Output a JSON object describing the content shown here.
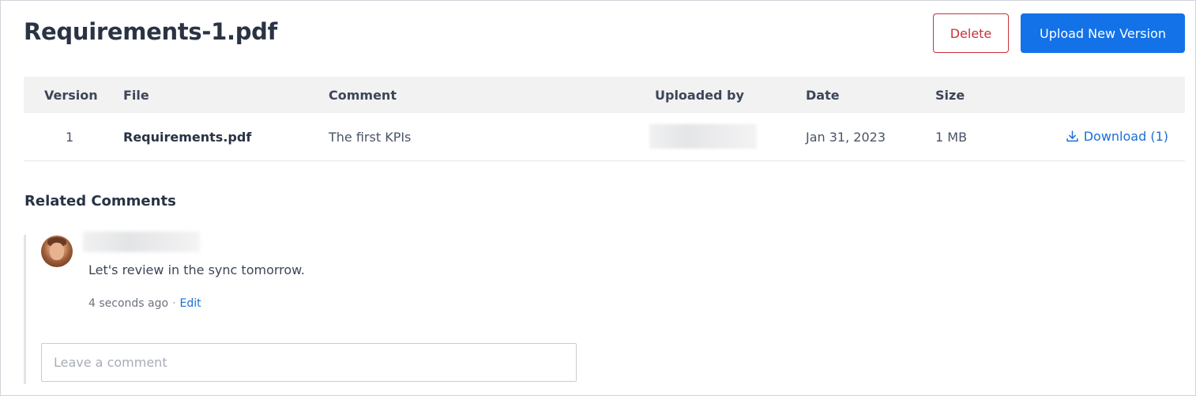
{
  "document": {
    "title": "Requirements-1.pdf"
  },
  "actions": {
    "delete_label": "Delete",
    "upload_label": "Upload New Version"
  },
  "table": {
    "headers": {
      "version": "Version",
      "file": "File",
      "comment": "Comment",
      "uploaded_by": "Uploaded by",
      "date": "Date",
      "size": "Size"
    },
    "rows": [
      {
        "version": "1",
        "file": "Requirements.pdf",
        "comment": "The first KPIs",
        "date": "Jan 31, 2023",
        "size": "1 MB",
        "download_label": "Download (1)"
      }
    ]
  },
  "related_comments": {
    "title": "Related Comments",
    "items": [
      {
        "text": "Let's review in the sync tomorrow.",
        "time": "4 seconds ago",
        "separator": "·",
        "edit_label": "Edit"
      }
    ],
    "input_placeholder": "Leave a comment"
  },
  "colors": {
    "primary": "#1372e8",
    "danger": "#c8323a",
    "link": "#1a6fd6"
  },
  "icons": {
    "download": "download-icon",
    "avatar": "user-avatar"
  }
}
